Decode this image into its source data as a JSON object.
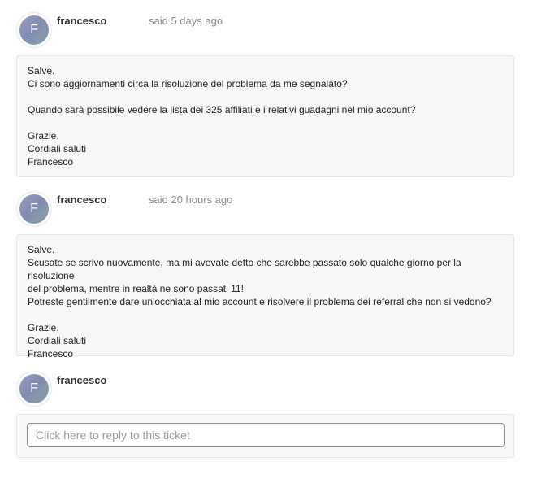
{
  "comments": [
    {
      "avatar_letter": "F",
      "author": "francesco",
      "time": "said 5 days ago",
      "lines": [
        "Salve.",
        "Ci sono aggiornamenti circa la risoluzione del problema da me segnalato?",
        "",
        "Quando sarà possibile vedere la lista dei 325 affiliati e i relativi guadagni nel mio account?",
        "",
        "Grazie.",
        "Cordiali saluti",
        "Francesco"
      ]
    },
    {
      "avatar_letter": "F",
      "author": "francesco",
      "time": "said 20 hours ago",
      "lines": [
        "Salve.",
        "Scusate se scrivo nuovamente, ma mi avevate detto che sarebbe passato solo qualche giorno per la risoluzione",
        "del problema, mentre in realtà ne sono passati 11!",
        "Potreste gentilmente dare un'occhiata al mio account e risolvere il problema dei referral che non si vedono?",
        "",
        "Grazie.",
        "Cordiali saluti",
        "Francesco"
      ]
    }
  ],
  "reply": {
    "avatar_letter": "F",
    "author": "francesco",
    "placeholder": "Click here to reply to this ticket"
  }
}
